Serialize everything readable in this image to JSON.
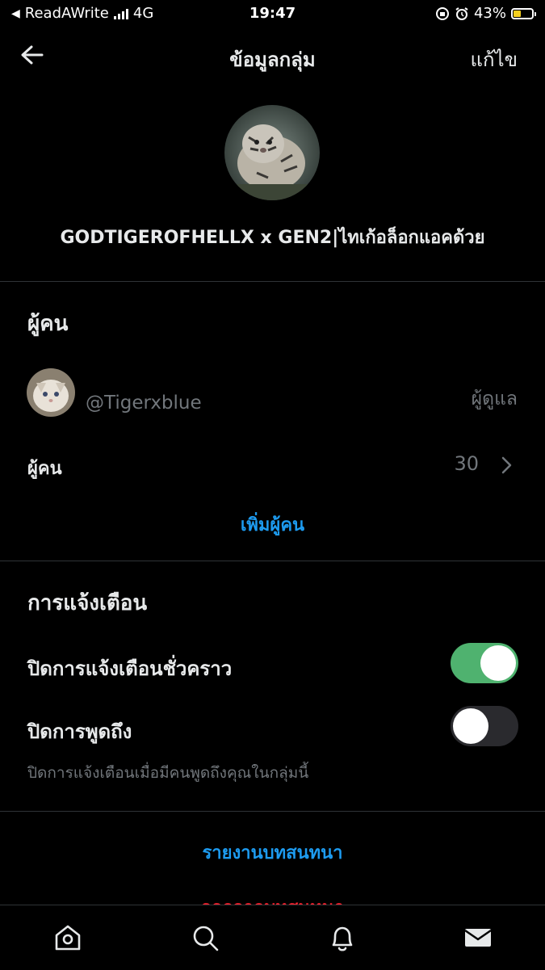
{
  "status_bar": {
    "carrier": "ReadAWrite",
    "network": "4G",
    "time": "19:47",
    "battery": "43%",
    "battery_level": 0.43
  },
  "nav": {
    "title": "ข้อมูลกลุ่ม",
    "edit": "แก้ไข",
    "back_icon": "back-arrow-icon"
  },
  "group": {
    "name": "GODTIGEROFHELLX x GEN2|ไทเก้อล็อกแอคด้วย"
  },
  "people_section": {
    "title": "ผู้คน",
    "admin": {
      "handle": "@Tigerxblue",
      "role": "ผู้ดูแล"
    },
    "people_label": "ผู้คน",
    "people_count": "30",
    "add_people": "เพิ่มผู้คน"
  },
  "notifications": {
    "title": "การแจ้งเตือน",
    "snooze": {
      "label": "ปิดการแจ้งเตือนชั่วคราว",
      "on": true
    },
    "mentions": {
      "label": "ปิดการพูดถึง",
      "on": false
    },
    "hint": "ปิดการแจ้งเตือนเมื่อมีคนพูดถึงคุณในกลุ่มนี้"
  },
  "actions": {
    "report": "รายงานบทสนทนา",
    "leave": "ออกจากบทสนทนา"
  },
  "tabs": [
    "home-icon",
    "search-icon",
    "bell-icon",
    "mail-icon"
  ],
  "colors": {
    "accent": "#1d9bf0",
    "danger": "#f4212e",
    "toggle_on": "#4fb26f",
    "muted": "#71767b"
  }
}
